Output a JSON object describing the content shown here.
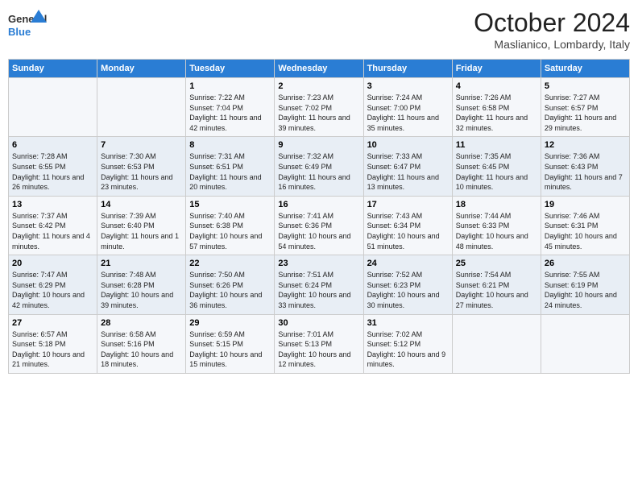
{
  "header": {
    "logo_general": "General",
    "logo_blue": "Blue",
    "month_title": "October 2024",
    "location": "Maslianico, Lombardy, Italy"
  },
  "days_of_week": [
    "Sunday",
    "Monday",
    "Tuesday",
    "Wednesday",
    "Thursday",
    "Friday",
    "Saturday"
  ],
  "weeks": [
    [
      {
        "day": "",
        "info": ""
      },
      {
        "day": "",
        "info": ""
      },
      {
        "day": "1",
        "info": "Sunrise: 7:22 AM\nSunset: 7:04 PM\nDaylight: 11 hours and 42 minutes."
      },
      {
        "day": "2",
        "info": "Sunrise: 7:23 AM\nSunset: 7:02 PM\nDaylight: 11 hours and 39 minutes."
      },
      {
        "day": "3",
        "info": "Sunrise: 7:24 AM\nSunset: 7:00 PM\nDaylight: 11 hours and 35 minutes."
      },
      {
        "day": "4",
        "info": "Sunrise: 7:26 AM\nSunset: 6:58 PM\nDaylight: 11 hours and 32 minutes."
      },
      {
        "day": "5",
        "info": "Sunrise: 7:27 AM\nSunset: 6:57 PM\nDaylight: 11 hours and 29 minutes."
      }
    ],
    [
      {
        "day": "6",
        "info": "Sunrise: 7:28 AM\nSunset: 6:55 PM\nDaylight: 11 hours and 26 minutes."
      },
      {
        "day": "7",
        "info": "Sunrise: 7:30 AM\nSunset: 6:53 PM\nDaylight: 11 hours and 23 minutes."
      },
      {
        "day": "8",
        "info": "Sunrise: 7:31 AM\nSunset: 6:51 PM\nDaylight: 11 hours and 20 minutes."
      },
      {
        "day": "9",
        "info": "Sunrise: 7:32 AM\nSunset: 6:49 PM\nDaylight: 11 hours and 16 minutes."
      },
      {
        "day": "10",
        "info": "Sunrise: 7:33 AM\nSunset: 6:47 PM\nDaylight: 11 hours and 13 minutes."
      },
      {
        "day": "11",
        "info": "Sunrise: 7:35 AM\nSunset: 6:45 PM\nDaylight: 11 hours and 10 minutes."
      },
      {
        "day": "12",
        "info": "Sunrise: 7:36 AM\nSunset: 6:43 PM\nDaylight: 11 hours and 7 minutes."
      }
    ],
    [
      {
        "day": "13",
        "info": "Sunrise: 7:37 AM\nSunset: 6:42 PM\nDaylight: 11 hours and 4 minutes."
      },
      {
        "day": "14",
        "info": "Sunrise: 7:39 AM\nSunset: 6:40 PM\nDaylight: 11 hours and 1 minute."
      },
      {
        "day": "15",
        "info": "Sunrise: 7:40 AM\nSunset: 6:38 PM\nDaylight: 10 hours and 57 minutes."
      },
      {
        "day": "16",
        "info": "Sunrise: 7:41 AM\nSunset: 6:36 PM\nDaylight: 10 hours and 54 minutes."
      },
      {
        "day": "17",
        "info": "Sunrise: 7:43 AM\nSunset: 6:34 PM\nDaylight: 10 hours and 51 minutes."
      },
      {
        "day": "18",
        "info": "Sunrise: 7:44 AM\nSunset: 6:33 PM\nDaylight: 10 hours and 48 minutes."
      },
      {
        "day": "19",
        "info": "Sunrise: 7:46 AM\nSunset: 6:31 PM\nDaylight: 10 hours and 45 minutes."
      }
    ],
    [
      {
        "day": "20",
        "info": "Sunrise: 7:47 AM\nSunset: 6:29 PM\nDaylight: 10 hours and 42 minutes."
      },
      {
        "day": "21",
        "info": "Sunrise: 7:48 AM\nSunset: 6:28 PM\nDaylight: 10 hours and 39 minutes."
      },
      {
        "day": "22",
        "info": "Sunrise: 7:50 AM\nSunset: 6:26 PM\nDaylight: 10 hours and 36 minutes."
      },
      {
        "day": "23",
        "info": "Sunrise: 7:51 AM\nSunset: 6:24 PM\nDaylight: 10 hours and 33 minutes."
      },
      {
        "day": "24",
        "info": "Sunrise: 7:52 AM\nSunset: 6:23 PM\nDaylight: 10 hours and 30 minutes."
      },
      {
        "day": "25",
        "info": "Sunrise: 7:54 AM\nSunset: 6:21 PM\nDaylight: 10 hours and 27 minutes."
      },
      {
        "day": "26",
        "info": "Sunrise: 7:55 AM\nSunset: 6:19 PM\nDaylight: 10 hours and 24 minutes."
      }
    ],
    [
      {
        "day": "27",
        "info": "Sunrise: 6:57 AM\nSunset: 5:18 PM\nDaylight: 10 hours and 21 minutes."
      },
      {
        "day": "28",
        "info": "Sunrise: 6:58 AM\nSunset: 5:16 PM\nDaylight: 10 hours and 18 minutes."
      },
      {
        "day": "29",
        "info": "Sunrise: 6:59 AM\nSunset: 5:15 PM\nDaylight: 10 hours and 15 minutes."
      },
      {
        "day": "30",
        "info": "Sunrise: 7:01 AM\nSunset: 5:13 PM\nDaylight: 10 hours and 12 minutes."
      },
      {
        "day": "31",
        "info": "Sunrise: 7:02 AM\nSunset: 5:12 PM\nDaylight: 10 hours and 9 minutes."
      },
      {
        "day": "",
        "info": ""
      },
      {
        "day": "",
        "info": ""
      }
    ]
  ]
}
